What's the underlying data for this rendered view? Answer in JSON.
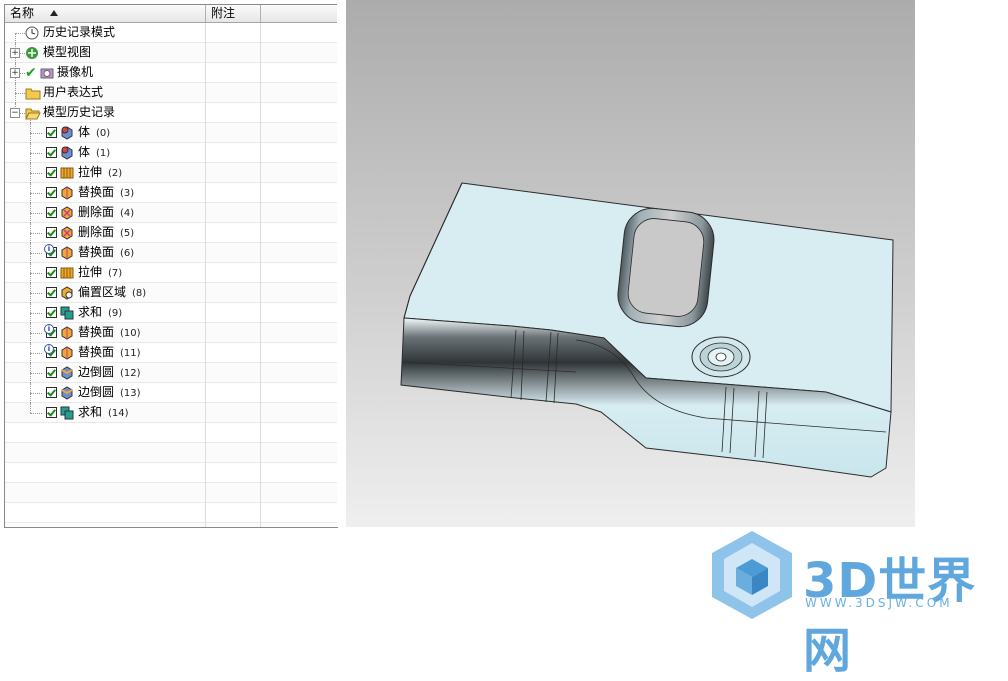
{
  "navigator": {
    "columns": {
      "name": "名称",
      "note": "附注"
    },
    "items": [
      {
        "label": "历史记录模式",
        "num": "",
        "icon": "clock-icon",
        "checked": false,
        "info": false,
        "expander": ""
      },
      {
        "label": "模型视图",
        "num": "",
        "icon": "model-view-icon",
        "checked": false,
        "info": false,
        "expander": "+"
      },
      {
        "label": "摄像机",
        "num": "",
        "icon": "camera-icon",
        "checked": true,
        "info": false,
        "expander": "+"
      },
      {
        "label": "用户表达式",
        "num": "",
        "icon": "folder-icon",
        "checked": false,
        "info": false,
        "expander": ""
      },
      {
        "label": "模型历史记录",
        "num": "",
        "icon": "open-folder-icon",
        "checked": false,
        "info": false,
        "expander": "−"
      },
      {
        "label": "体",
        "num": "(0)",
        "icon": "body-icon",
        "checked": true,
        "info": false
      },
      {
        "label": "体",
        "num": "(1)",
        "icon": "body-icon",
        "checked": true,
        "info": false
      },
      {
        "label": "拉伸",
        "num": "(2)",
        "icon": "extrude-icon",
        "checked": true,
        "info": false
      },
      {
        "label": "替换面",
        "num": "(3)",
        "icon": "replace-face-icon",
        "checked": true,
        "info": false
      },
      {
        "label": "删除面",
        "num": "(4)",
        "icon": "delete-face-icon",
        "checked": true,
        "info": false
      },
      {
        "label": "删除面",
        "num": "(5)",
        "icon": "delete-face-icon",
        "checked": true,
        "info": false
      },
      {
        "label": "替换面",
        "num": "(6)",
        "icon": "replace-face-icon",
        "checked": true,
        "info": true
      },
      {
        "label": "拉伸",
        "num": "(7)",
        "icon": "extrude-icon",
        "checked": true,
        "info": false
      },
      {
        "label": "偏置区域",
        "num": "(8)",
        "icon": "offset-region-icon",
        "checked": true,
        "info": false
      },
      {
        "label": "求和",
        "num": "(9)",
        "icon": "unite-icon",
        "checked": true,
        "info": false
      },
      {
        "label": "替换面",
        "num": "(10)",
        "icon": "replace-face-icon",
        "checked": true,
        "info": true
      },
      {
        "label": "替换面",
        "num": "(11)",
        "icon": "replace-face-icon",
        "checked": true,
        "info": true
      },
      {
        "label": "边倒圆",
        "num": "(12)",
        "icon": "edge-blend-icon",
        "checked": true,
        "info": false
      },
      {
        "label": "边倒圆",
        "num": "(13)",
        "icon": "edge-blend-icon",
        "checked": true,
        "info": false
      },
      {
        "label": "求和",
        "num": "(14)",
        "icon": "unite-icon",
        "checked": true,
        "info": false
      }
    ],
    "empty_rows": 6
  },
  "watermark": {
    "text": "3D世界网",
    "url": "WWW.3DSJW.COM"
  },
  "colors": {
    "part_top": "#d9eef2",
    "part_side": "#c6e2ea",
    "accent": "#5fa7dc"
  }
}
